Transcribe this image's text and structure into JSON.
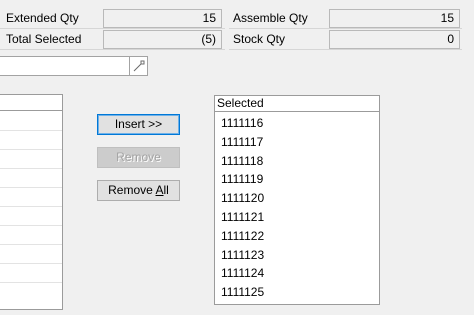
{
  "summary": {
    "extended_qty_label": "Extended Qty",
    "extended_qty_value": "15",
    "total_selected_label": "Total Selected",
    "total_selected_value": "(5)",
    "assemble_qty_label": "Assemble Qty",
    "assemble_qty_value": "15",
    "stock_qty_label": "Stock Qty",
    "stock_qty_value": "0"
  },
  "search": {
    "value": "",
    "lookup_icon": "lookup-arrow-icon"
  },
  "buttons": {
    "insert": "Insert >>",
    "remove": "Remove",
    "remove_all_prefix": "Remove ",
    "remove_all_accel": "A",
    "remove_all_suffix": "ll"
  },
  "selected": {
    "header": "Selected",
    "items": [
      "1111116",
      "1111117",
      "1111118",
      "1111119",
      "1111120",
      "1111121",
      "1111122",
      "1111123",
      "1111124",
      "1111125"
    ]
  }
}
